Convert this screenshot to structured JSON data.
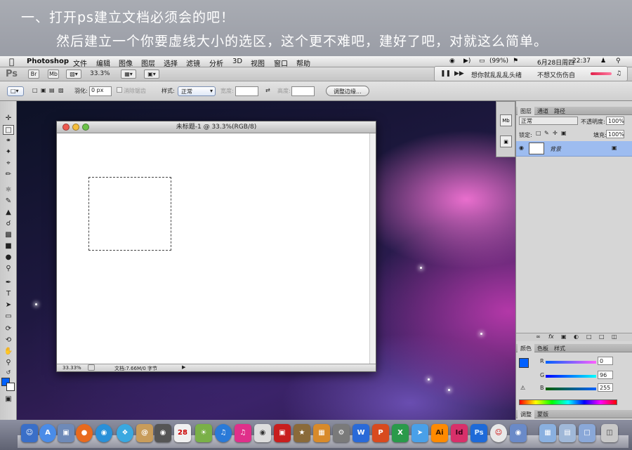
{
  "caption": {
    "line1": "一、打开ps建立文档必须会的吧！",
    "line2": "然后建立一个你要虚线大小的选区，这个更不难吧，建好了吧，对就这么简单。"
  },
  "menubar": {
    "app_name": "Photoshop",
    "menus": [
      "文件",
      "编辑",
      "图像",
      "图层",
      "选择",
      "滤镜",
      "分析",
      "3D",
      "视图",
      "窗口",
      "帮助"
    ],
    "battery": "(99%)",
    "date": "6月28日周四",
    "time": "22:37"
  },
  "appbar": {
    "ps_logo": "Ps",
    "br_label": "Br",
    "mb_label": "Mb",
    "zoom": "33.3%"
  },
  "music": {
    "title": "想你就乱乱乱头绪",
    "artist": "不想又伤伤自"
  },
  "options": {
    "feather_label": "羽化:",
    "feather_value": "0 px",
    "antialias_label": "消除锯齿",
    "style_label": "样式:",
    "style_value": "正常",
    "width_label": "宽度:",
    "height_label": "高度:",
    "refine_edge": "调整边缘..."
  },
  "document": {
    "title": "未标题-1 @ 33.3%(RGB/8)",
    "zoom": "33.33%",
    "doc_info": "文档:7.66M/0 字节"
  },
  "layers_panel": {
    "tabs": [
      "图层",
      "通道",
      "路径"
    ],
    "blend_mode": "正常",
    "opacity_label": "不透明度:",
    "opacity_value": "100%",
    "lock_label": "锁定:",
    "fill_label": "填充:",
    "fill_value": "100%",
    "layer_name": "背景"
  },
  "color_panel": {
    "tabs": [
      "颜色",
      "色板",
      "样式"
    ],
    "r_label": "R",
    "g_label": "G",
    "b_label": "B",
    "r_value": "0",
    "g_value": "96",
    "b_value": "255",
    "foreground": "#0060ff"
  },
  "adjust_panel": {
    "tabs": [
      "调整",
      "蒙版"
    ]
  },
  "dock": {
    "ai_label": "Ai",
    "id_label": "Id",
    "ps_label": "Ps",
    "cal_day": "28"
  },
  "colors": {
    "selection_highlight": "#9dbcf0",
    "accent": "#0060ff"
  }
}
